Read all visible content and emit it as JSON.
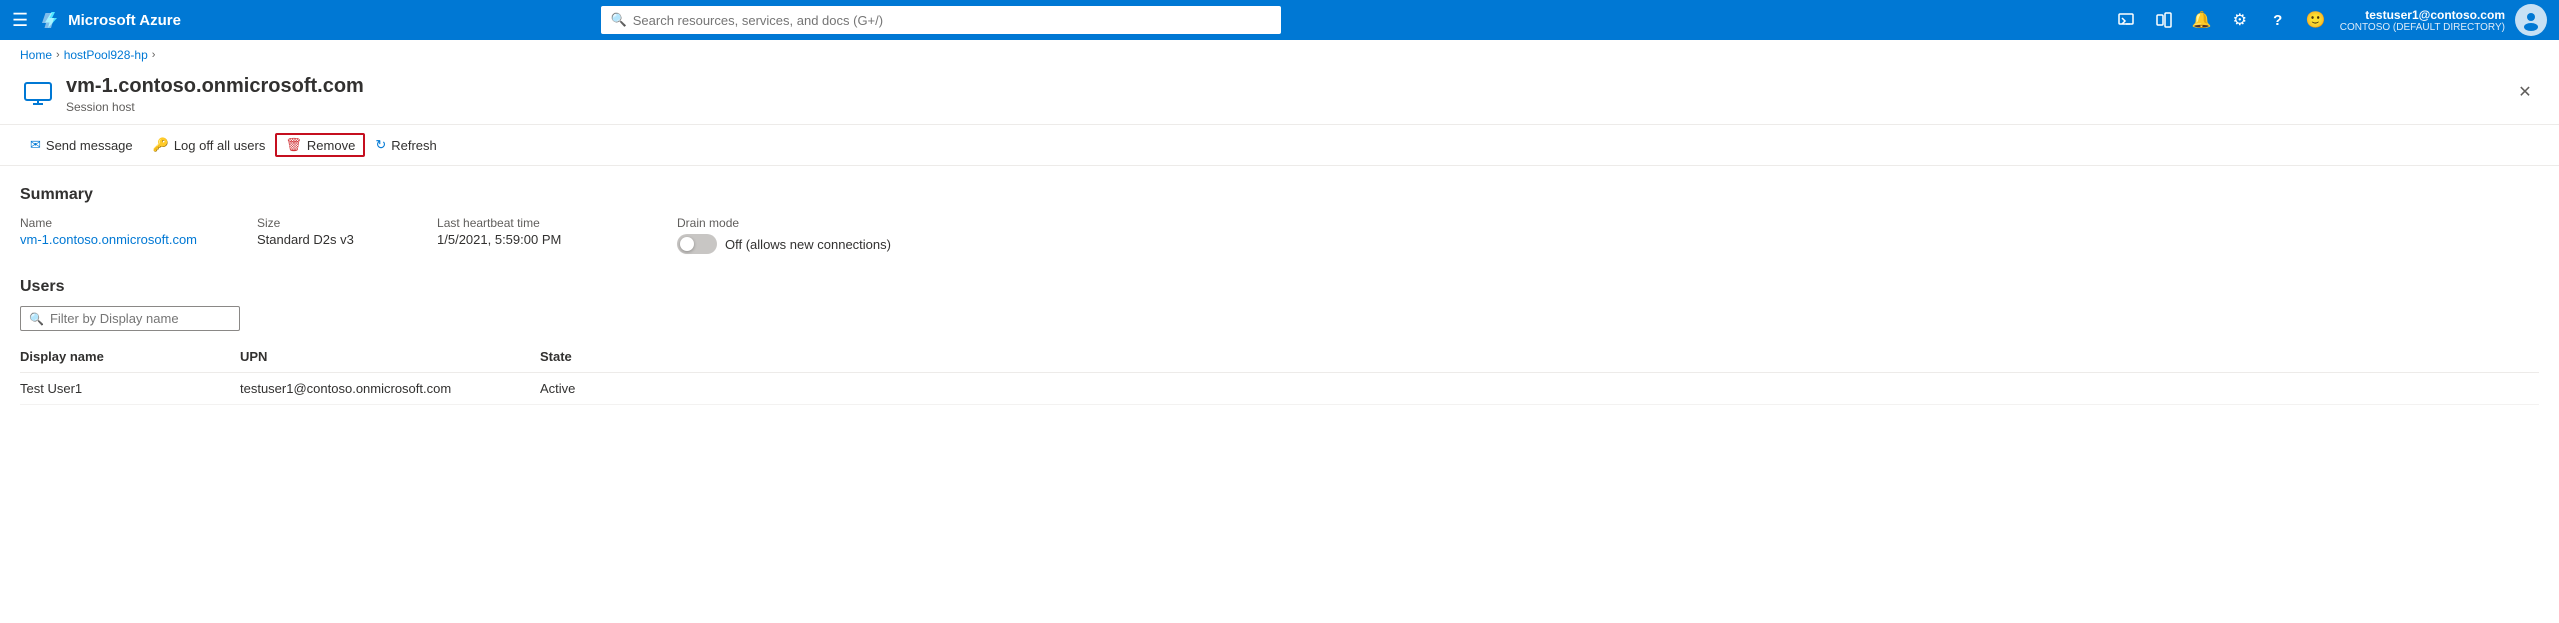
{
  "topNav": {
    "hamburger_label": "☰",
    "logo_text": "Microsoft Azure",
    "search_placeholder": "Search resources, services, and docs (G+/)",
    "icons": [
      {
        "name": "cloud-shell-icon",
        "symbol": "⬛"
      },
      {
        "name": "portal-settings-icon",
        "symbol": "⬒"
      },
      {
        "name": "notifications-icon",
        "symbol": "🔔"
      },
      {
        "name": "settings-icon",
        "symbol": "⚙"
      },
      {
        "name": "help-icon",
        "symbol": "?"
      },
      {
        "name": "feedback-icon",
        "symbol": "☺"
      }
    ],
    "user_name": "testuser1@contoso.com",
    "user_tenant": "CONTOSO (DEFAULT DIRECTORY)"
  },
  "breadcrumb": {
    "items": [
      "Home",
      "hostPool928-hp"
    ],
    "separators": [
      ">",
      ">"
    ]
  },
  "panelHeader": {
    "title": "vm-1.contoso.onmicrosoft.com",
    "subtitle": "Session host",
    "close_label": "✕"
  },
  "actionBar": {
    "send_message_label": "Send message",
    "log_off_label": "Log off all users",
    "remove_label": "Remove",
    "refresh_label": "Refresh"
  },
  "summary": {
    "section_title": "Summary",
    "name_label": "Name",
    "name_value": "vm-1.contoso.onmicrosoft.com",
    "size_label": "Size",
    "size_value": "Standard D2s v3",
    "heartbeat_label": "Last heartbeat time",
    "heartbeat_value": "1/5/2021, 5:59:00 PM",
    "drain_label": "Drain mode",
    "drain_toggle_state": "Off (allows new connections)"
  },
  "users": {
    "section_title": "Users",
    "filter_placeholder": "Filter by Display name",
    "columns": [
      "Display name",
      "UPN",
      "State"
    ],
    "rows": [
      {
        "display_name": "Test User1",
        "upn": "testuser1@contoso.onmicrosoft.com",
        "state": "Active"
      }
    ]
  }
}
